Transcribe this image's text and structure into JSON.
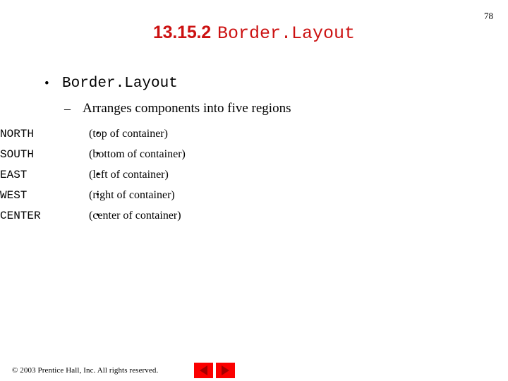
{
  "slide": {
    "page_number": "78",
    "title": {
      "number": "13.15.2",
      "code": "Border.Layout"
    },
    "bullets": {
      "level1_marker": "•",
      "level1_text": "Border.Layout",
      "level2_marker": "–",
      "level2_text": "Arranges components into five regions",
      "level3_marker": "•"
    },
    "regions": [
      {
        "name": "NORTH",
        "description": "(top of container)"
      },
      {
        "name": "SOUTH",
        "description": "(bottom of container)"
      },
      {
        "name": "EAST",
        "description": "(left of container)"
      },
      {
        "name": "WEST",
        "description": "(right of container)"
      },
      {
        "name": "CENTER",
        "description": "(center of container)"
      }
    ],
    "footer": {
      "copyright": "© 2003 Prentice Hall, Inc. All rights reserved.",
      "prev_label": "◀",
      "next_label": "▶"
    },
    "colors": {
      "title": "#cc1111",
      "nav_button": "#fb0000",
      "nav_arrow": "#a50000",
      "text": "#000000",
      "background": "#ffffff"
    }
  }
}
